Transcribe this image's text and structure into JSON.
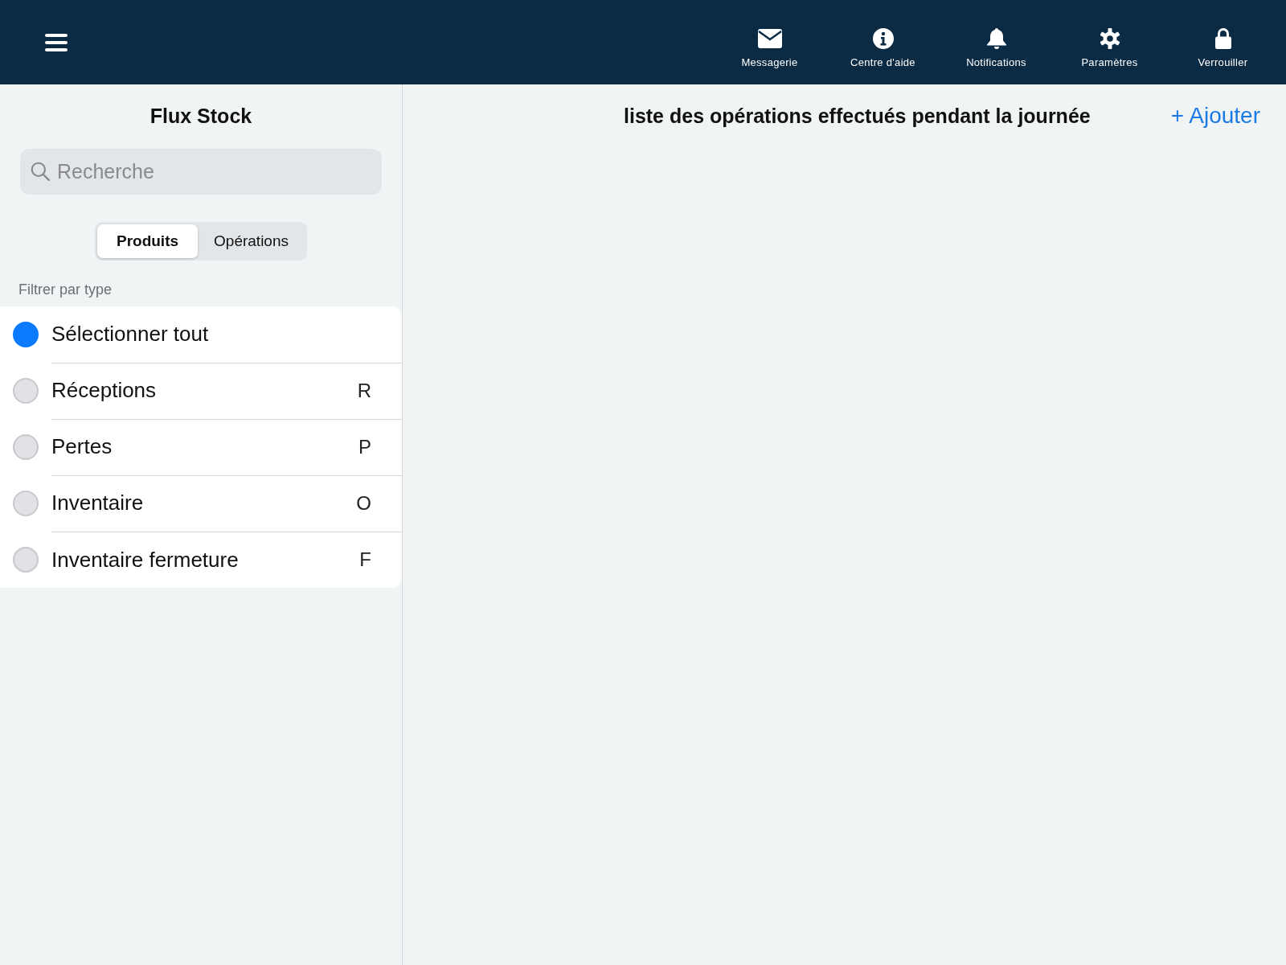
{
  "toolbar": {
    "items": [
      {
        "label": "Messagerie"
      },
      {
        "label": "Centre d'aide"
      },
      {
        "label": "Notifications"
      },
      {
        "label": "Paramètres"
      },
      {
        "label": "Verrouiller"
      }
    ]
  },
  "sidebar": {
    "title": "Flux Stock",
    "search": {
      "placeholder": "Recherche"
    },
    "segments": [
      {
        "label": "Produits",
        "selected": true
      },
      {
        "label": "Opérations",
        "selected": false
      }
    ],
    "filter_label": "Filtrer par type",
    "filters": [
      {
        "label": "Sélectionner tout",
        "selected": true
      },
      {
        "label": "Réceptions",
        "shortcut": "R",
        "selected": false
      },
      {
        "label": "Pertes",
        "shortcut": "P",
        "selected": false
      },
      {
        "label": "Inventaire",
        "shortcut": "O",
        "selected": false
      },
      {
        "label": "Inventaire fermeture",
        "shortcut": "F",
        "selected": false
      }
    ]
  },
  "main": {
    "title": "liste des opérations effectués pendant la journée",
    "add_button": "+ Ajouter"
  }
}
